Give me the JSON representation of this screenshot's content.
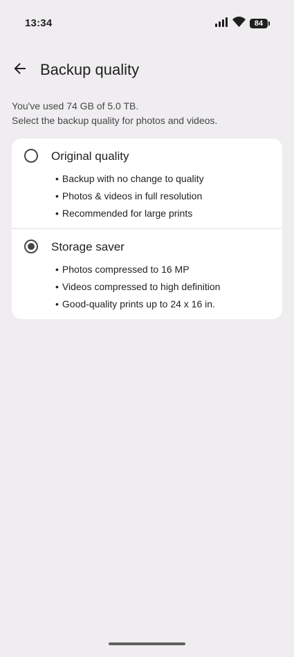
{
  "status_bar": {
    "time": "13:34",
    "battery_level": "84",
    "icons": [
      "signal-icon",
      "wifi-icon",
      "battery-icon"
    ]
  },
  "header": {
    "back_icon": "arrow-left-icon",
    "title": "Backup quality"
  },
  "description": {
    "usage": "You've used 74 GB of 5.0 TB.",
    "instruction": "Select the backup quality for photos and videos."
  },
  "options": [
    {
      "label": "Original quality",
      "selected": false,
      "bullets": [
        "Backup with no change to quality",
        "Photos & videos in full resolution",
        "Recommended for large prints"
      ]
    },
    {
      "label": "Storage saver",
      "selected": true,
      "bullets": [
        "Photos compressed to 16 MP",
        "Videos compressed to high definition",
        "Good-quality prints up to 24 x 16 in."
      ]
    }
  ],
  "colors": {
    "background": "#efedef",
    "card": "#ffffff",
    "text_primary": "#1f1f1f",
    "text_secondary": "#444746",
    "radio": "#444746"
  }
}
